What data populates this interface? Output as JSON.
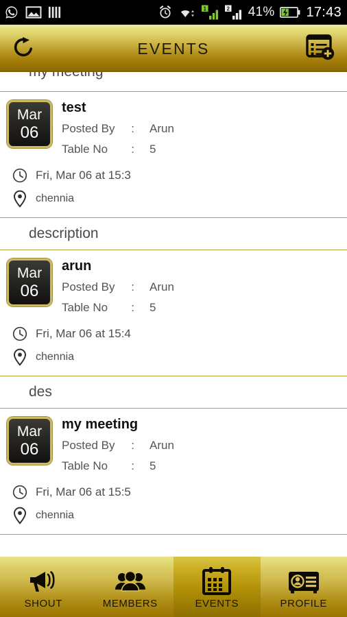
{
  "statusbar": {
    "left_icons": [
      "whatsapp-icon",
      "gallery-icon",
      "bars-icon"
    ],
    "right_icons": [
      "alarm-icon",
      "wifi-icon",
      "signal-sim1-icon",
      "signal-sim2-icon"
    ],
    "battery_percent": "41%",
    "battery_icon": "battery-charging-icon",
    "time": "17:43",
    "sim1_label": "1",
    "sim2_label": "2"
  },
  "header": {
    "title": "EVENTS",
    "refresh_icon": "refresh-icon",
    "add_event_icon": "add-event-icon"
  },
  "colors": {
    "gold_light": "#e9e484",
    "gold_dark": "#8f6a00",
    "divider": "#b9a44a",
    "badge_border": "#cdb95f",
    "badge_bg": "#121110",
    "text_primary": "#101010",
    "text_secondary": "#555555"
  },
  "list": {
    "top_cut_text": "my meeting",
    "labels": {
      "posted_by": "Posted By",
      "table_no": "Table No",
      "colon": ":"
    },
    "events": [
      {
        "month": "Mar",
        "day": "06",
        "title": "test",
        "posted_by": "Arun",
        "table_no": "5",
        "time": "Fri, Mar 06 at 15:3",
        "location": "chennia",
        "clock_icon": "clock-icon",
        "pin_icon": "location-pin-icon",
        "description": "description"
      },
      {
        "month": "Mar",
        "day": "06",
        "title": "arun",
        "posted_by": "Arun",
        "table_no": "5",
        "time": "Fri, Mar 06 at 15:4",
        "location": "chennia",
        "clock_icon": "clock-icon",
        "pin_icon": "location-pin-icon",
        "description": "des"
      },
      {
        "month": "Mar",
        "day": "06",
        "title": "my meeting",
        "posted_by": "Arun",
        "table_no": "5",
        "time": "Fri, Mar 06 at 15:5",
        "location": "chennia",
        "clock_icon": "clock-icon",
        "pin_icon": "location-pin-icon",
        "description": ""
      }
    ]
  },
  "tabbar": {
    "tabs": [
      {
        "label": "SHOUT",
        "icon": "megaphone-icon",
        "active": false
      },
      {
        "label": "MEMBERS",
        "icon": "people-icon",
        "active": false
      },
      {
        "label": "EVENTS",
        "icon": "calendar-icon",
        "active": true
      },
      {
        "label": "PROFILE",
        "icon": "id-card-icon",
        "active": false
      }
    ]
  }
}
